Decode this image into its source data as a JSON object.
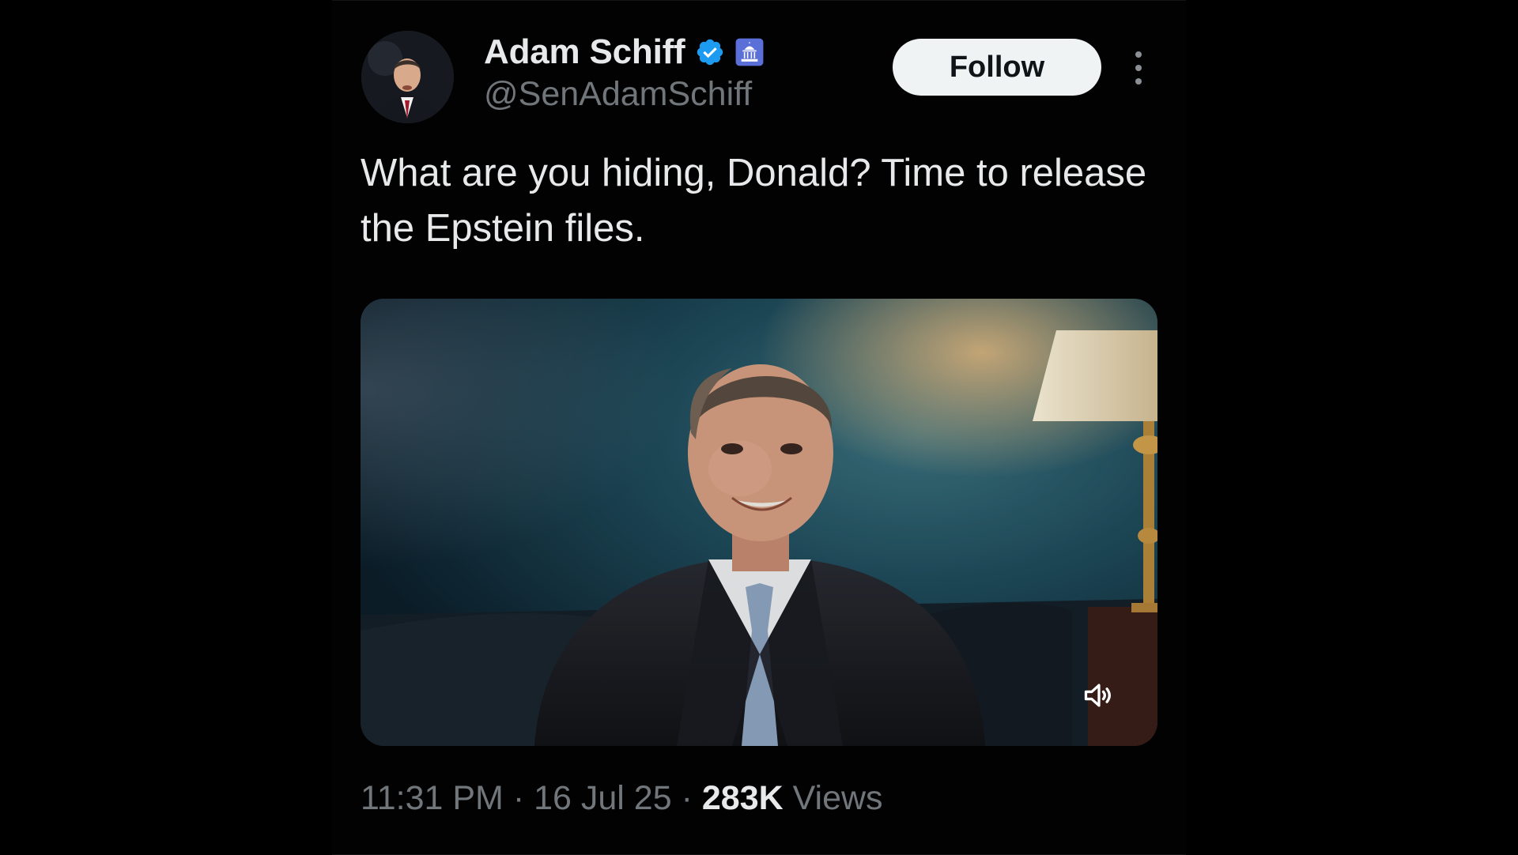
{
  "author": {
    "display_name": "Adam Schiff",
    "handle": "@SenAdamSchiff",
    "verified_icon": "verified-badge-icon",
    "affiliation_icon": "government-capitol-icon"
  },
  "actions": {
    "follow_label": "Follow",
    "more_icon": "more-vertical-icon"
  },
  "tweet": {
    "text": "What are you hiding, Donald? Time to release the Epstein files."
  },
  "media": {
    "type": "video",
    "volume_icon": "volume-muted-icon"
  },
  "meta": {
    "time": "11:31 PM",
    "separator": "·",
    "date": "16 Jul 25",
    "views_count": "283K",
    "views_label": "Views"
  },
  "colors": {
    "background": "#000000",
    "primary_text": "#e7e9ea",
    "secondary_text": "#71767b",
    "verified_blue": "#1d9bf0",
    "follow_bg": "#eff3f4"
  }
}
